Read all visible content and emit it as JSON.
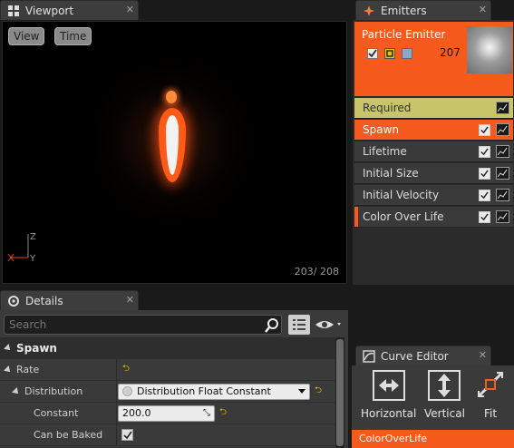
{
  "viewport": {
    "tab_label": "Viewport",
    "view_button": "View",
    "time_button": "Time",
    "frame_count": "203/ 208",
    "axis": {
      "z": "Z",
      "y": "Y"
    }
  },
  "emitters": {
    "tab_label": "Emitters",
    "emitter_name": "Particle Emitter",
    "particle_count": "207",
    "modules": [
      {
        "label": "Required",
        "checkbox": false
      },
      {
        "label": "Spawn",
        "checkbox": true
      },
      {
        "label": "Lifetime",
        "checkbox": true
      },
      {
        "label": "Initial Size",
        "checkbox": true
      },
      {
        "label": "Initial Velocity",
        "checkbox": true
      },
      {
        "label": "Color Over Life",
        "checkbox": true
      }
    ]
  },
  "details": {
    "tab_label": "Details",
    "search_placeholder": "Search",
    "section_title": "Spawn",
    "rows": {
      "rate_label": "Rate",
      "distribution_label": "Distribution",
      "distribution_value": "Distribution Float Constant",
      "constant_label": "Constant",
      "constant_value": "200.0",
      "baked_label": "Can be Baked",
      "baked_checked": true
    }
  },
  "curve_editor": {
    "tab_label": "Curve Editor",
    "buttons": [
      "Horizontal",
      "Vertical",
      "Fit"
    ],
    "track_label": "ColorOverLife"
  },
  "colors": {
    "accent": "#f75a1d",
    "required_module": "#c8c46a",
    "panel": "#3a3a3a"
  }
}
